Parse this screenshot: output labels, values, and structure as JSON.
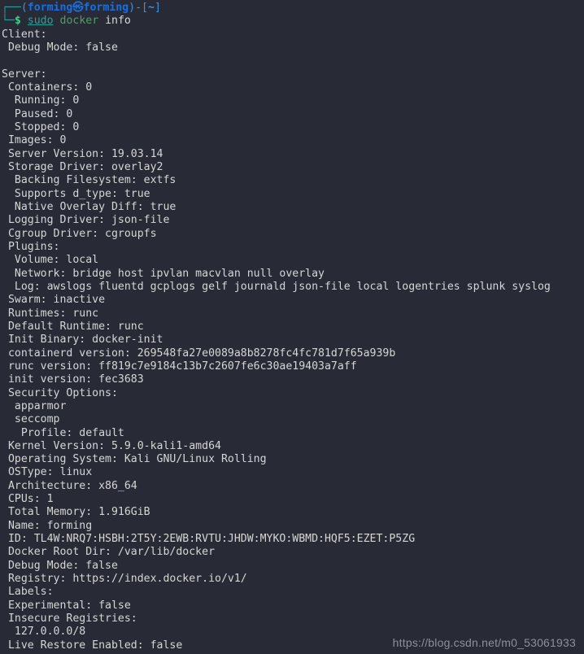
{
  "terminal": {
    "background_color": "#282a36",
    "foreground_color": "#d6d6d6",
    "prompt": {
      "frame_top": "┌──",
      "frame_bottom": "└─",
      "open_paren": "(",
      "user": "forming",
      "kali_symbol": "㉿",
      "host": "forming",
      "close_paren": ")",
      "dash": "-",
      "open_bracket": "[",
      "path": "~",
      "close_bracket": "]",
      "dollar": "$"
    },
    "command": {
      "sudo": "sudo",
      "binary": "docker",
      "argument": "info"
    },
    "output_lines": [
      "Client:",
      " Debug Mode: false",
      "",
      "Server:",
      " Containers: 0",
      "  Running: 0",
      "  Paused: 0",
      "  Stopped: 0",
      " Images: 0",
      " Server Version: 19.03.14",
      " Storage Driver: overlay2",
      "  Backing Filesystem: extfs",
      "  Supports d_type: true",
      "  Native Overlay Diff: true",
      " Logging Driver: json-file",
      " Cgroup Driver: cgroupfs",
      " Plugins:",
      "  Volume: local",
      "  Network: bridge host ipvlan macvlan null overlay",
      "  Log: awslogs fluentd gcplogs gelf journald json-file local logentries splunk syslog",
      " Swarm: inactive",
      " Runtimes: runc",
      " Default Runtime: runc",
      " Init Binary: docker-init",
      " containerd version: 269548fa27e0089a8b8278fc4fc781d7f65a939b",
      " runc version: ff819c7e9184c13b7c2607fe6c30ae19403a7aff",
      " init version: fec3683",
      " Security Options:",
      "  apparmor",
      "  seccomp",
      "   Profile: default",
      " Kernel Version: 5.9.0-kali1-amd64",
      " Operating System: Kali GNU/Linux Rolling",
      " OSType: linux",
      " Architecture: x86_64",
      " CPUs: 1",
      " Total Memory: 1.916GiB",
      " Name: forming",
      " ID: TL4W:NRQ7:HSBH:2T5Y:2EWB:RVTU:JHDW:MYKO:WBMD:HQF5:EZET:P5ZG",
      " Docker Root Dir: /var/lib/docker",
      " Debug Mode: false",
      " Registry: https://index.docker.io/v1/",
      " Labels:",
      " Experimental: false",
      " Insecure Registries:",
      "  127.0.0.0/8",
      " Live Restore Enabled: false"
    ]
  },
  "watermark": {
    "text": "https://blog.csdn.net/m0_53061933"
  }
}
